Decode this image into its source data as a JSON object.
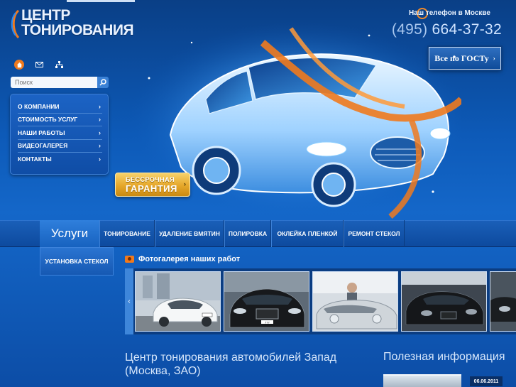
{
  "logo": {
    "line1": "ЦЕНТР",
    "line2": "ТОНИРОВАНИЯ"
  },
  "header": {
    "phone_label": "Наш телефон в Москве",
    "phone_code": "(495)",
    "phone_number": "664-37-32",
    "gost_label": "Все по ГОСТу"
  },
  "search": {
    "placeholder": "Поиск"
  },
  "sidebar": {
    "items": [
      {
        "label": "О КОМПАНИИ"
      },
      {
        "label": "СТОИМОСТЬ УСЛУГ"
      },
      {
        "label": "НАШИ РАБОТЫ"
      },
      {
        "label": "ВИДЕОГАЛЕРЕЯ"
      },
      {
        "label": "КОНТАКТЫ"
      }
    ]
  },
  "warranty": {
    "line1": "БЕССРОЧНАЯ",
    "line2": "ГАРАНТИЯ"
  },
  "services": {
    "title": "Услуги",
    "tabs": [
      {
        "label": "ТОНИРОВАНИЕ"
      },
      {
        "label": "УДАЛЕНИЕ ВМЯТИН"
      },
      {
        "label": "ПОЛИРОВКА"
      },
      {
        "label": "ОКЛЕЙКА ПЛЕНКОЙ"
      },
      {
        "label": "РЕМОНТ СТЕКОЛ"
      },
      {
        "label": "УСТАНОВКА СТЕКОЛ"
      }
    ]
  },
  "gallery": {
    "title": "Фотогалерея наших работ",
    "prev_arrow": "‹",
    "plate_text": "777"
  },
  "main": {
    "title": "Центр тонирования автомобилей Запад (Москва, ЗАО)"
  },
  "info": {
    "title": "Полезная информация",
    "news_date": "06.06.2011"
  },
  "colors": {
    "accent_orange": "#f07a1e",
    "background_blue": "#0d5ab8",
    "gold": "#e5a72a"
  }
}
